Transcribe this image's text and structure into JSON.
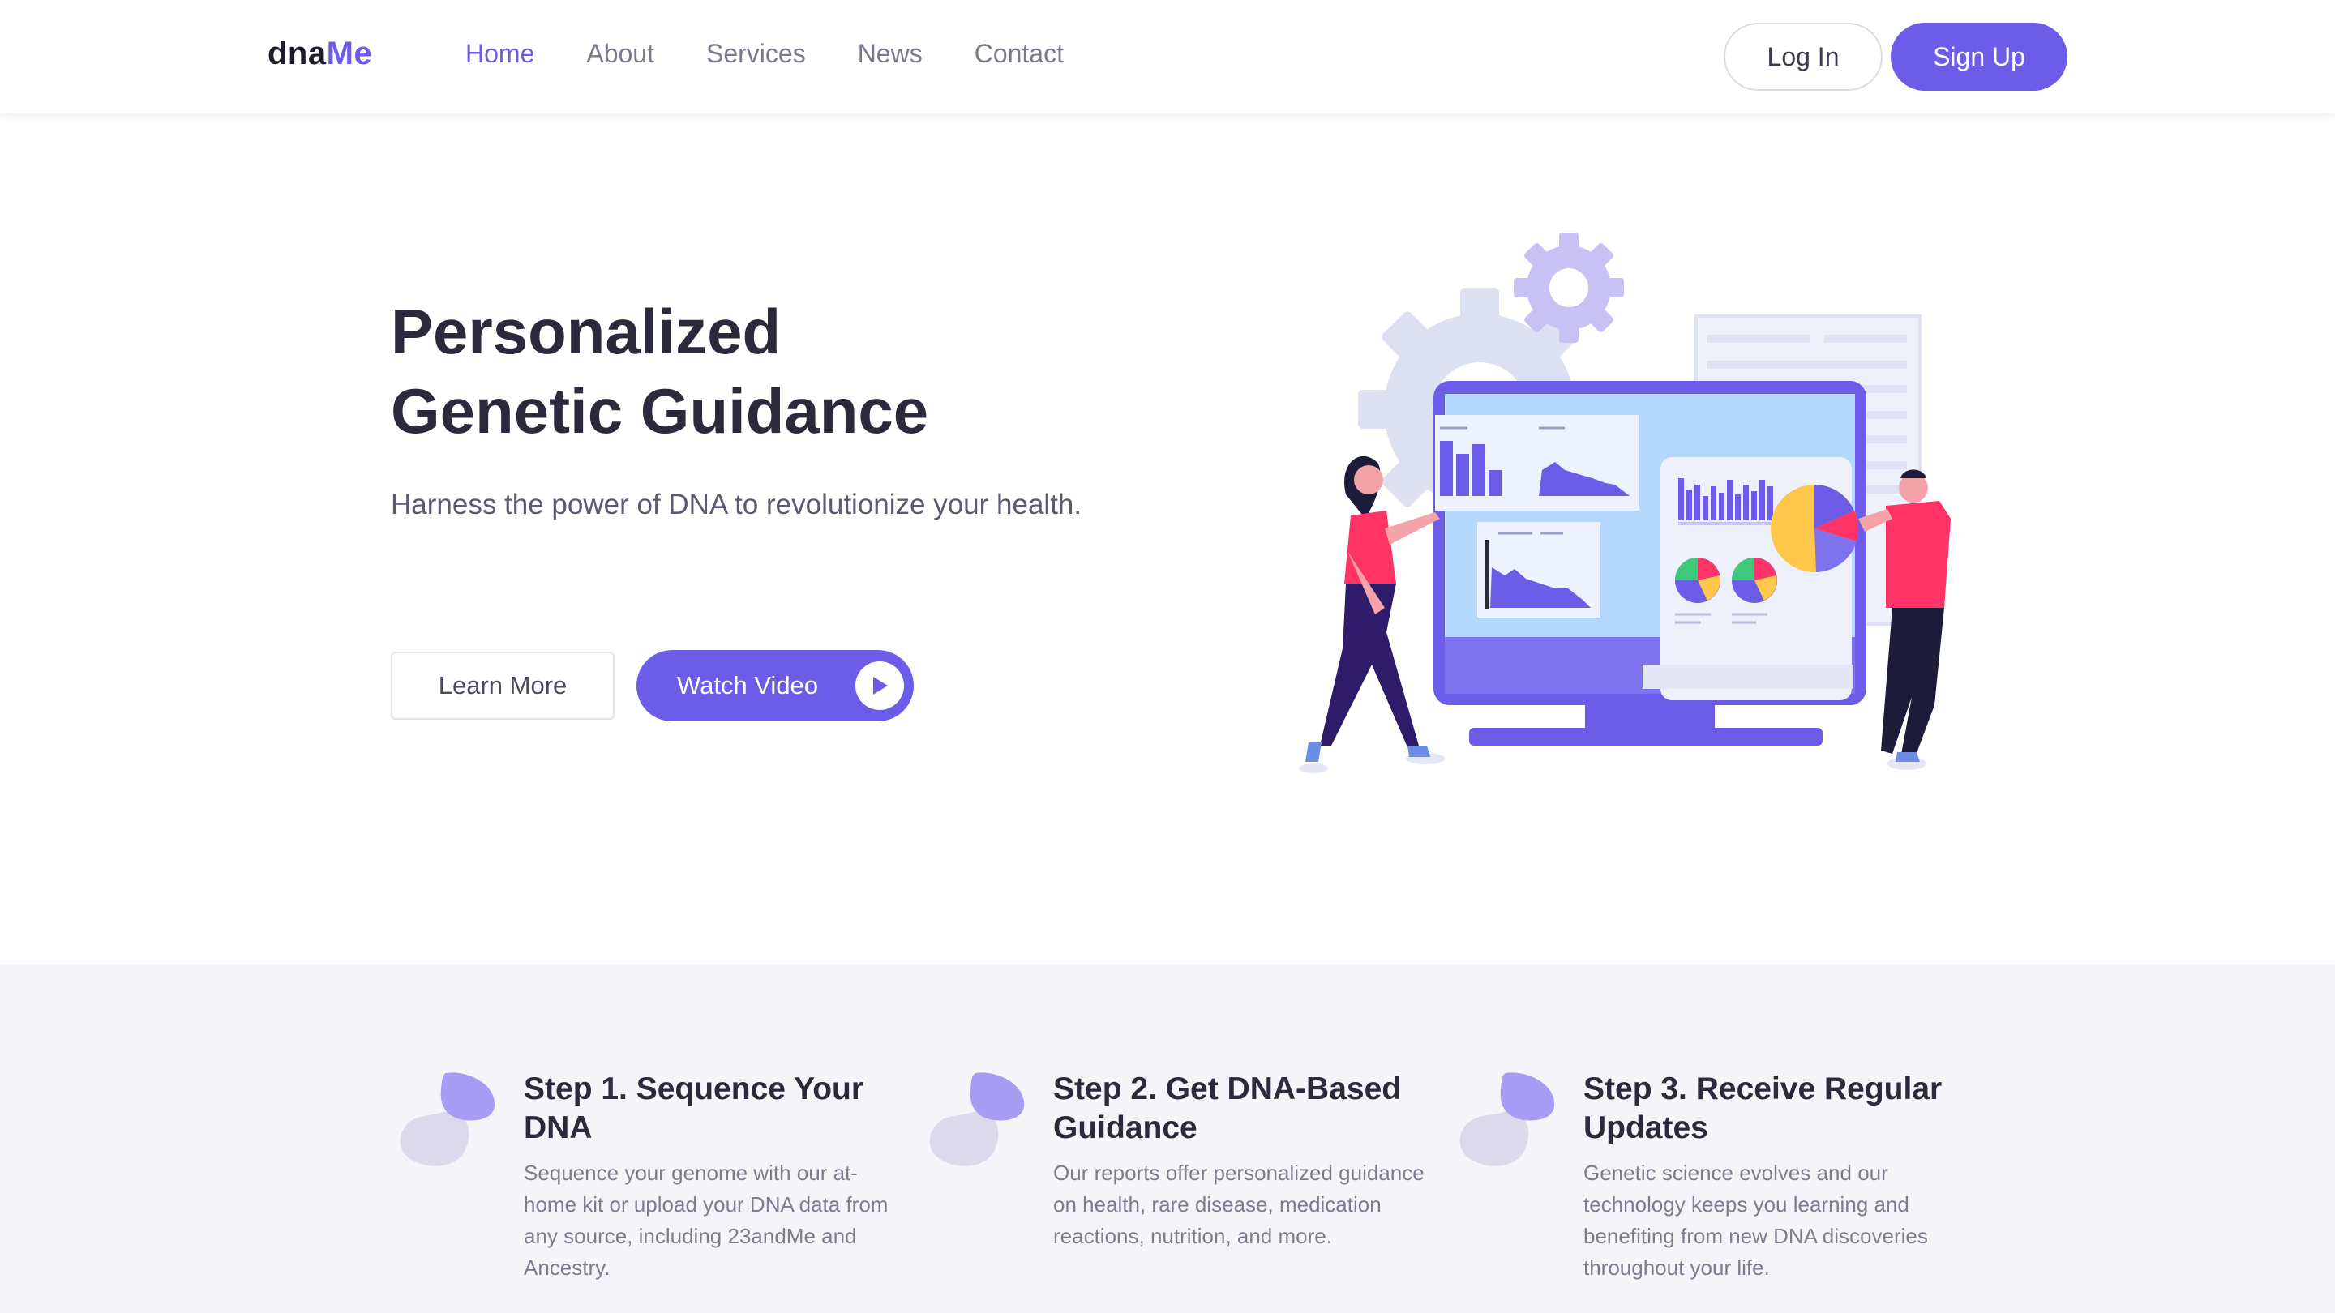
{
  "nav": {
    "logo_part1": "dna",
    "logo_part2": "Me",
    "items": [
      {
        "label": "Home",
        "active": true
      },
      {
        "label": "About",
        "active": false
      },
      {
        "label": "Services",
        "active": false
      },
      {
        "label": "News",
        "active": false
      },
      {
        "label": "Contact",
        "active": false
      }
    ],
    "login_label": "Log In",
    "signup_label": "Sign Up"
  },
  "hero": {
    "title_line1": "Personalized",
    "title_line2": "Genetic Guidance",
    "subtitle": "Harness the power of DNA to revolutionize your health.",
    "learn_more_label": "Learn More",
    "watch_video_label": "Watch Video"
  },
  "steps": [
    {
      "title": "Step 1. Sequence Your DNA",
      "description": "Sequence your genome with our at-home kit or upload your DNA data from any source, including 23andMe and Ancestry."
    },
    {
      "title": "Step 2. Get DNA-Based Guidance",
      "description": "Our reports offer personalized guidance on health, rare disease, medication reactions, nutrition, and more."
    },
    {
      "title": "Step 3. Receive Regular Updates",
      "description": "Genetic science evolves and our technology keeps you learning and benefiting from new DNA discoveries throughout your life."
    }
  ],
  "colors": {
    "accent": "#6c5ce7",
    "text_dark": "#2a2a3c",
    "steps_bg": "#f4f4f9",
    "pink": "#ff3366"
  },
  "icons": [
    "play-icon",
    "blob-icon"
  ]
}
